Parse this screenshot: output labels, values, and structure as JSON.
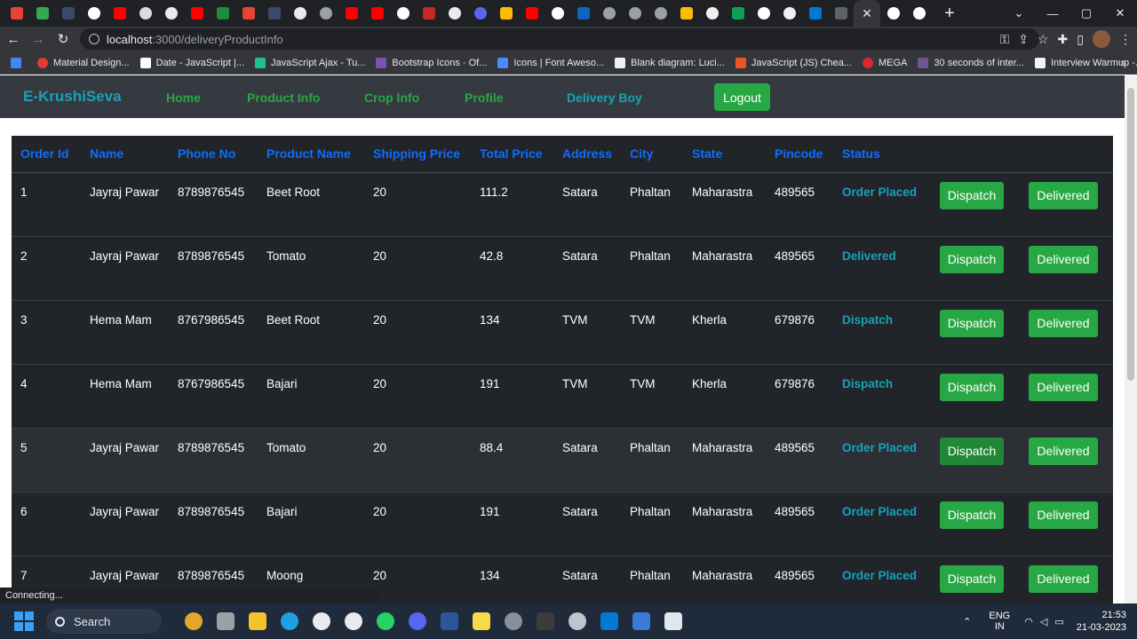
{
  "browser": {
    "active_tab_close": "✕",
    "new_tab": "+",
    "url_host": "localhost",
    "url_path": ":3000/deliveryProductInfo",
    "bookmarks": [
      {
        "label": "Material Design...",
        "color": "#e53935"
      },
      {
        "label": "Date - JavaScript |...",
        "color": "#ffffff"
      },
      {
        "label": "JavaScript Ajax - Tu...",
        "color": "#21c08b"
      },
      {
        "label": "Bootstrap Icons · Of...",
        "color": "#7952b3"
      },
      {
        "label": "Icons | Font Aweso...",
        "color": "#4a8cff"
      },
      {
        "label": "Blank diagram: Luci...",
        "color": "#f0f0f0"
      },
      {
        "label": "JavaScript (JS) Chea...",
        "color": "#e8562a"
      },
      {
        "label": "MEGA",
        "color": "#d9272e"
      },
      {
        "label": "30 seconds of inter...",
        "color": "#6e5494"
      },
      {
        "label": "Interview Warmup -...",
        "color": "#f1f3f4"
      }
    ],
    "bookmarks_more": "»",
    "status_text": "Connecting..."
  },
  "app": {
    "brand": "E-KrushiSeva",
    "nav": {
      "home": "Home",
      "product_info": "Product Info",
      "crop_info": "Crop Info",
      "profile": "Profile",
      "delivery_boy": "Delivery Boy"
    },
    "logout": "Logout"
  },
  "table": {
    "headers": [
      "Order Id",
      "Name",
      "Phone No",
      "Product Name",
      "Shipping Price",
      "Total Price",
      "Address",
      "City",
      "State",
      "Pincode",
      "Status"
    ],
    "dispatch_label": "Dispatch",
    "delivered_label": "Delivered",
    "rows": [
      {
        "id": "1",
        "name": "Jayraj Pawar",
        "phone": "8789876545",
        "product": "Beet Root",
        "shipping": "20",
        "total": "111.2",
        "address": "Satara",
        "city": "Phaltan",
        "state": "Maharastra",
        "pincode": "489565",
        "status": "Order Placed"
      },
      {
        "id": "2",
        "name": "Jayraj Pawar",
        "phone": "8789876545",
        "product": "Tomato",
        "shipping": "20",
        "total": "42.8",
        "address": "Satara",
        "city": "Phaltan",
        "state": "Maharastra",
        "pincode": "489565",
        "status": "Delivered"
      },
      {
        "id": "3",
        "name": "Hema Mam",
        "phone": "8767986545",
        "product": "Beet Root",
        "shipping": "20",
        "total": "134",
        "address": "TVM",
        "city": "TVM",
        "state": "Kherla",
        "pincode": "679876",
        "status": "Dispatch"
      },
      {
        "id": "4",
        "name": "Hema Mam",
        "phone": "8767986545",
        "product": "Bajari",
        "shipping": "20",
        "total": "191",
        "address": "TVM",
        "city": "TVM",
        "state": "Kherla",
        "pincode": "679876",
        "status": "Dispatch"
      },
      {
        "id": "5",
        "name": "Jayraj Pawar",
        "phone": "8789876545",
        "product": "Tomato",
        "shipping": "20",
        "total": "88.4",
        "address": "Satara",
        "city": "Phaltan",
        "state": "Maharastra",
        "pincode": "489565",
        "status": "Order Placed"
      },
      {
        "id": "6",
        "name": "Jayraj Pawar",
        "phone": "8789876545",
        "product": "Bajari",
        "shipping": "20",
        "total": "191",
        "address": "Satara",
        "city": "Phaltan",
        "state": "Maharastra",
        "pincode": "489565",
        "status": "Order Placed"
      },
      {
        "id": "7",
        "name": "Jayraj Pawar",
        "phone": "8789876545",
        "product": "Moong",
        "shipping": "20",
        "total": "134",
        "address": "Satara",
        "city": "Phaltan",
        "state": "Maharastra",
        "pincode": "489565",
        "status": "Order Placed"
      }
    ]
  },
  "taskbar": {
    "search_label": "Search",
    "lang_top": "ENG",
    "lang_bottom": "IN",
    "time": "21:53",
    "date": "21-03-2023"
  }
}
